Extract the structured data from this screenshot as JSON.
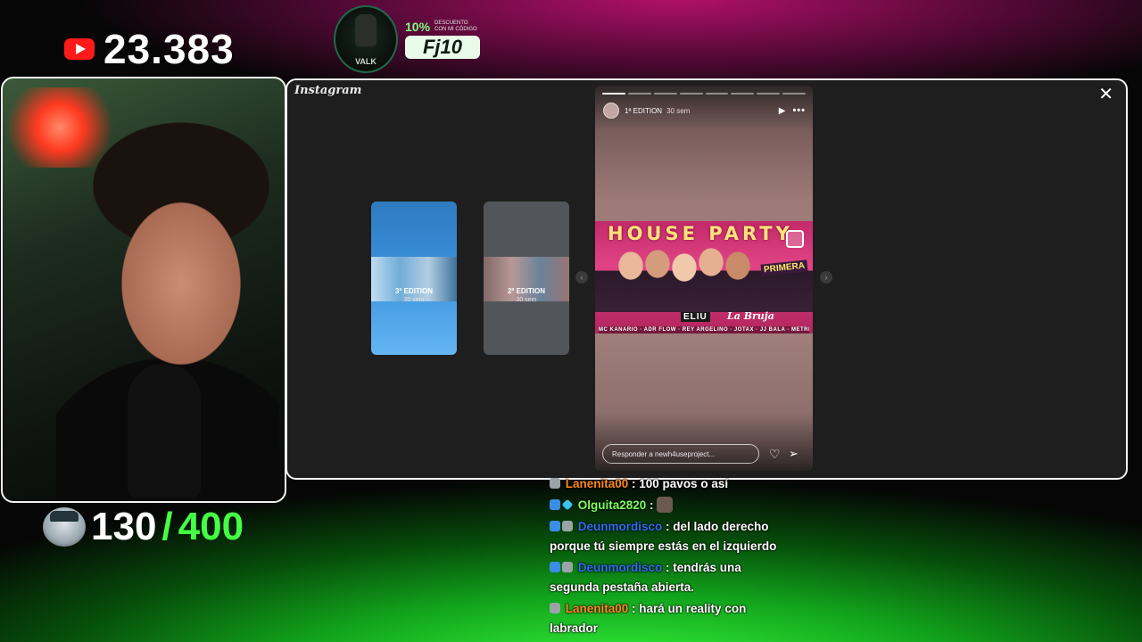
{
  "stream": {
    "subscriber_count": "23.383",
    "goal": {
      "current": "130",
      "separator": "/",
      "target": "400"
    },
    "sponsor": {
      "brand": "VALK",
      "discount": "10%",
      "discount_text": "DESCUENTO CON MI CÓDIGO",
      "code": "Fj10"
    }
  },
  "browser": {
    "app_name": "Instagram",
    "close_icon": "close-icon"
  },
  "stories": {
    "thumbnails": [
      {
        "title": "3ª EDITION",
        "time": "30 sem"
      },
      {
        "title": "2ª EDITION",
        "time": "30 sem"
      }
    ],
    "active": {
      "username": "1ª EDITION",
      "time": "30 sem",
      "progress_total": 8,
      "progress_done": 1,
      "poster": {
        "title": "HOUSE PARTY",
        "tag": "PRIMERA",
        "brand": "ELIU",
        "brand2": "La Bruja",
        "guests": "MC KANARIO · ADR FLOW · REY ARGELINO · JOTAX · JJ BALA · METRIKA · DIMONTES"
      },
      "reply_placeholder": "Responder a newh4useproject..."
    }
  },
  "chat": {
    "messages": [
      {
        "user": "Lanenita00",
        "color": "orange",
        "text": ": 100 pavos o así"
      },
      {
        "user": "Olguita2820",
        "color": "green",
        "text": ":"
      },
      {
        "user": "Deunmordisco",
        "color": "blue",
        "text": ": del lado derecho porque tú siempre estás en el izquierdo"
      },
      {
        "user": "Deunmordisco",
        "color": "blue",
        "text": ": tendrás una segunda pestaña abierta."
      },
      {
        "user": "Lanenita00",
        "color": "orange",
        "text": ": hará un reality con labrador"
      }
    ]
  }
}
